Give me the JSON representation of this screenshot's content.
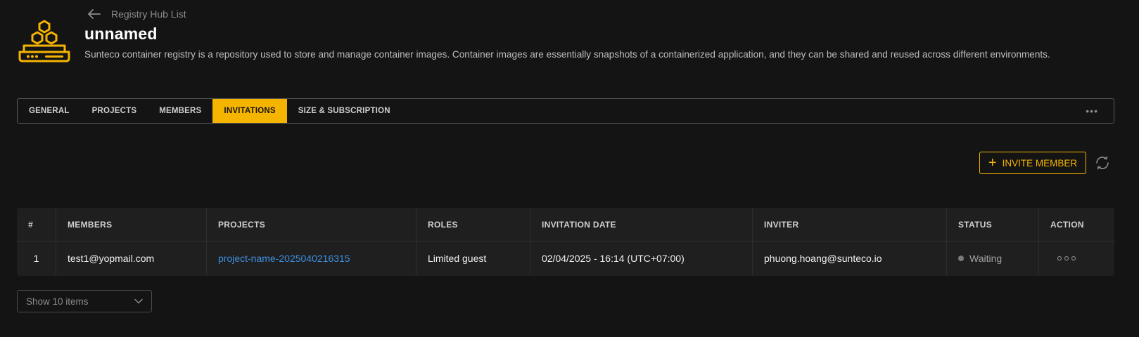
{
  "header": {
    "breadcrumb": "Registry Hub List",
    "title": "unnamed",
    "description": "Sunteco container registry is a repository used to store and manage container images. Container images are essentially snapshots of a containerized application, and they can be shared and reused across different environments.",
    "logo_icon": "container-registry-hex-icon",
    "accent_color": "#f5b400"
  },
  "tabs": [
    {
      "label": "GENERAL",
      "active": false
    },
    {
      "label": "PROJECTS",
      "active": false
    },
    {
      "label": "MEMBERS",
      "active": false
    },
    {
      "label": "INVITATIONS",
      "active": true
    },
    {
      "label": "SIZE & SUBSCRIPTION",
      "active": false
    }
  ],
  "tabs_more": "•••",
  "toolbar": {
    "invite_label": "INVITE MEMBER",
    "refresh_icon": "refresh-icon"
  },
  "table": {
    "columns": [
      "#",
      "MEMBERS",
      "PROJECTS",
      "ROLES",
      "INVITATION DATE",
      "INVITER",
      "STATUS",
      "ACTION"
    ],
    "rows": [
      {
        "index": "1",
        "member": "test1@yopmail.com",
        "project": "project-name-2025040216315",
        "role": "Limited guest",
        "invitation_date": "02/04/2025 - 16:14 (UTC+07:00)",
        "inviter": "phuong.hoang@sunteco.io",
        "status": "Waiting"
      }
    ]
  },
  "pagination": {
    "page_size_label": "Show 10 items"
  }
}
